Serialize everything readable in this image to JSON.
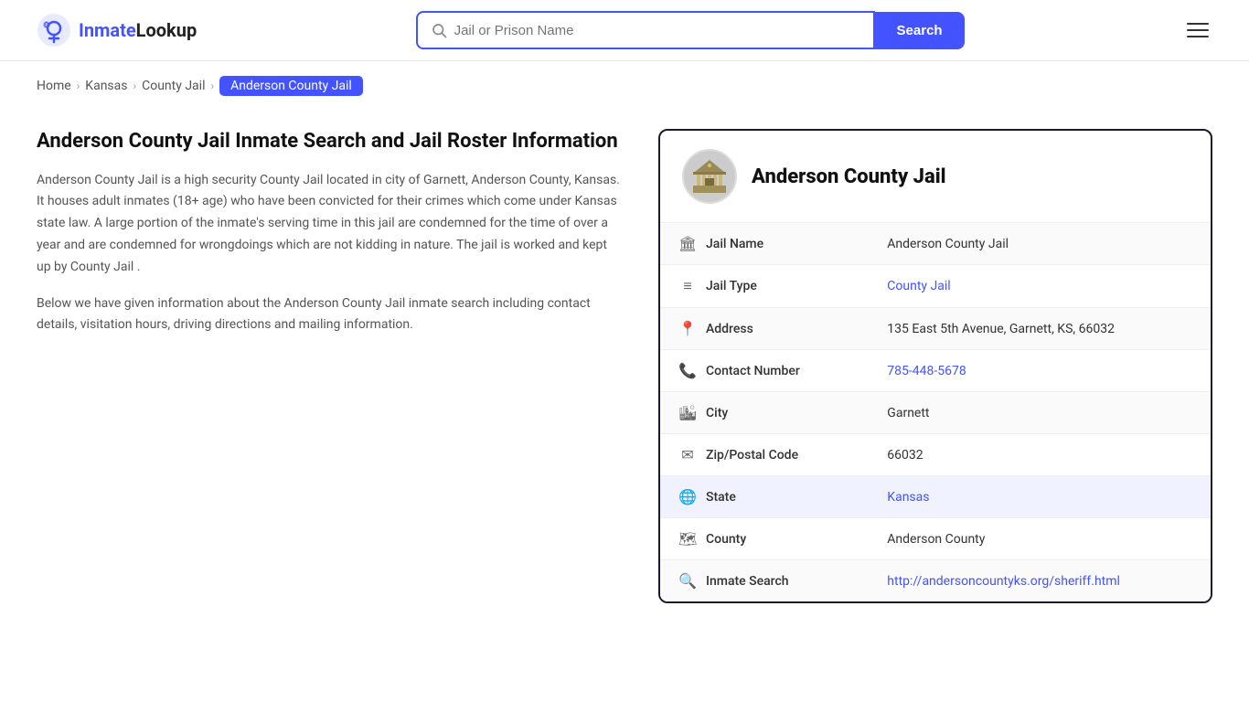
{
  "header": {
    "logo_brand": "InmateLookup",
    "logo_brand_highlight": "Inmate",
    "search_placeholder": "Jail or Prison Name",
    "search_button_label": "Search",
    "menu_label": "Menu"
  },
  "breadcrumb": {
    "items": [
      {
        "label": "Home",
        "href": "#"
      },
      {
        "label": "Kansas",
        "href": "#"
      },
      {
        "label": "County Jail",
        "href": "#"
      },
      {
        "label": "Anderson County Jail",
        "active": true
      }
    ]
  },
  "left_panel": {
    "title": "Anderson County Jail Inmate Search and Jail Roster Information",
    "description1": "Anderson County Jail is a high security County Jail located in city of Garnett, Anderson County, Kansas. It houses adult inmates (18+ age) who have been convicted for their crimes which come under Kansas state law. A large portion of the inmate's serving time in this jail are condemned for the time of over a year and are condemned for wrongdoings which are not kidding in nature. The jail is worked and kept up by County Jail .",
    "description2": "Below we have given information about the Anderson County Jail inmate search including contact details, visitation hours, driving directions and mailing information."
  },
  "info_card": {
    "jail_name_display": "Anderson County Jail",
    "rows": [
      {
        "icon": "🏛",
        "label": "Jail Name",
        "value": "Anderson County Jail",
        "link": null,
        "highlight": false
      },
      {
        "icon": "≡",
        "label": "Jail Type",
        "value": "County Jail",
        "link": "#",
        "highlight": false
      },
      {
        "icon": "📍",
        "label": "Address",
        "value": "135 East 5th Avenue, Garnett, KS, 66032",
        "link": null,
        "highlight": false
      },
      {
        "icon": "📞",
        "label": "Contact Number",
        "value": "785-448-5678",
        "link": "tel:785-448-5678",
        "highlight": false
      },
      {
        "icon": "🏙",
        "label": "City",
        "value": "Garnett",
        "link": null,
        "highlight": false
      },
      {
        "icon": "✉",
        "label": "Zip/Postal Code",
        "value": "66032",
        "link": null,
        "highlight": false
      },
      {
        "icon": "🌐",
        "label": "State",
        "value": "Kansas",
        "link": "#",
        "highlight": true
      },
      {
        "icon": "🗺",
        "label": "County",
        "value": "Anderson County",
        "link": null,
        "highlight": false
      },
      {
        "icon": "🔍",
        "label": "Inmate Search",
        "value": "http://andersoncountyks.org/sheriff.html",
        "link": "http://andersoncountyks.org/sheriff.html",
        "highlight": false
      }
    ]
  }
}
